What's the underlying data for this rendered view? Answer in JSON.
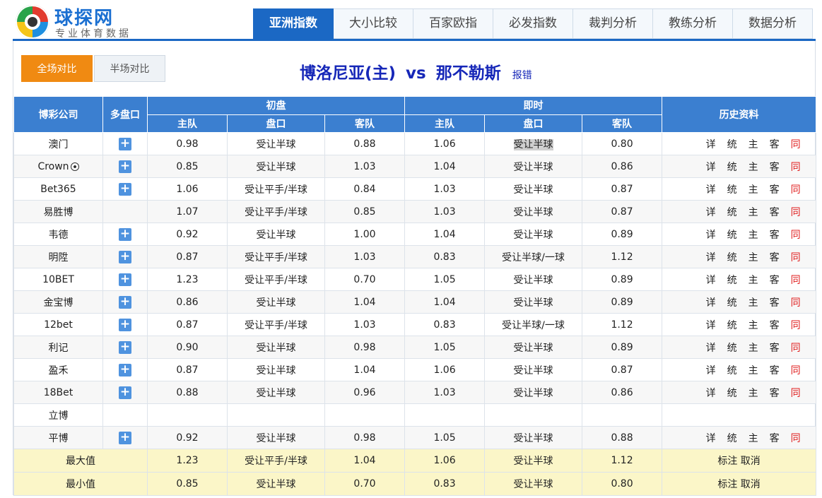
{
  "logo": {
    "name": "球探网",
    "slogan": "专业体育数据"
  },
  "tabs": [
    "亚洲指数",
    "大小比较",
    "百家欧指",
    "必发指数",
    "裁判分析",
    "教练分析",
    "数据分析"
  ],
  "switch": {
    "full": "全场对比",
    "half": "半场对比"
  },
  "match": {
    "home": "博洛尼亚(主)",
    "vs": "vs",
    "away": "那不勒斯",
    "report": "报错"
  },
  "headers": {
    "company": "博彩公司",
    "multi": "多盘口",
    "initial": "初盘",
    "live": "即时",
    "history": "历史资料",
    "home": "主队",
    "handicap": "盘口",
    "away": "客队"
  },
  "history_links": [
    "详",
    "统",
    "主",
    "客",
    "同"
  ],
  "rows": [
    {
      "company": "澳门",
      "plus": true,
      "i_home": "0.98",
      "i_hcp": "受让半球",
      "i_away": "0.88",
      "l_home": "1.06",
      "l_hcp": "受让半球",
      "l_away": "0.80",
      "hist": true,
      "hilite": true
    },
    {
      "company": "Crown",
      "ball": true,
      "plus": true,
      "i_home": "0.85",
      "i_hcp": "受让半球",
      "i_away": "1.03",
      "l_home": "1.04",
      "l_hcp": "受让半球",
      "l_away": "0.86",
      "hist": true
    },
    {
      "company": "Bet365",
      "plus": true,
      "i_home": "1.06",
      "i_hcp": "受让平手/半球",
      "i_away": "0.84",
      "l_home": "1.03",
      "l_hcp": "受让半球",
      "l_away": "0.87",
      "hist": true
    },
    {
      "company": "易胜博",
      "plus": false,
      "i_home": "1.07",
      "i_hcp": "受让平手/半球",
      "i_away": "0.85",
      "l_home": "1.03",
      "l_hcp": "受让半球",
      "l_away": "0.87",
      "hist": true
    },
    {
      "company": "韦德",
      "plus": true,
      "i_home": "0.92",
      "i_hcp": "受让半球",
      "i_away": "1.00",
      "l_home": "1.04",
      "l_hcp": "受让半球",
      "l_away": "0.89",
      "hist": true
    },
    {
      "company": "明陞",
      "plus": true,
      "i_home": "0.87",
      "i_hcp": "受让平手/半球",
      "i_away": "1.03",
      "l_home": "0.83",
      "l_hcp": "受让半球/一球",
      "l_away": "1.12",
      "hist": true
    },
    {
      "company": "10BET",
      "plus": true,
      "i_home": "1.23",
      "i_hcp": "受让平手/半球",
      "i_away": "0.70",
      "l_home": "1.05",
      "l_hcp": "受让半球",
      "l_away": "0.89",
      "hist": true
    },
    {
      "company": "金宝博",
      "plus": true,
      "i_home": "0.86",
      "i_hcp": "受让半球",
      "i_away": "1.04",
      "l_home": "1.04",
      "l_hcp": "受让半球",
      "l_away": "0.89",
      "hist": true
    },
    {
      "company": "12bet",
      "plus": true,
      "i_home": "0.87",
      "i_hcp": "受让平手/半球",
      "i_away": "1.03",
      "l_home": "0.83",
      "l_hcp": "受让半球/一球",
      "l_away": "1.12",
      "hist": true
    },
    {
      "company": "利记",
      "plus": true,
      "i_home": "0.90",
      "i_hcp": "受让半球",
      "i_away": "0.98",
      "l_home": "1.05",
      "l_hcp": "受让半球",
      "l_away": "0.89",
      "hist": true
    },
    {
      "company": "盈禾",
      "plus": true,
      "i_home": "0.87",
      "i_hcp": "受让半球",
      "i_away": "1.04",
      "l_home": "1.06",
      "l_hcp": "受让半球",
      "l_away": "0.87",
      "hist": true
    },
    {
      "company": "18Bet",
      "plus": true,
      "i_home": "0.88",
      "i_hcp": "受让半球",
      "i_away": "0.96",
      "l_home": "1.03",
      "l_hcp": "受让半球",
      "l_away": "0.86",
      "hist": true
    },
    {
      "company": "立博",
      "plus": false,
      "i_home": "",
      "i_hcp": "",
      "i_away": "",
      "l_home": "",
      "l_hcp": "",
      "l_away": "",
      "hist": false
    },
    {
      "company": "平博",
      "plus": true,
      "i_home": "0.92",
      "i_hcp": "受让半球",
      "i_away": "0.98",
      "l_home": "1.05",
      "l_hcp": "受让半球",
      "l_away": "0.88",
      "hist": true
    }
  ],
  "summary": [
    {
      "label": "最大值",
      "i_home": "1.23",
      "i_hcp": "受让平手/半球",
      "i_away": "1.04",
      "l_home": "1.06",
      "l_hcp": "受让半球",
      "l_away": "1.12",
      "mark": "标注",
      "cancel": "取消"
    },
    {
      "label": "最小值",
      "i_home": "0.85",
      "i_hcp": "受让半球",
      "i_away": "0.70",
      "l_home": "0.83",
      "l_hcp": "受让半球",
      "l_away": "0.80",
      "mark": "标注",
      "cancel": "取消"
    }
  ]
}
